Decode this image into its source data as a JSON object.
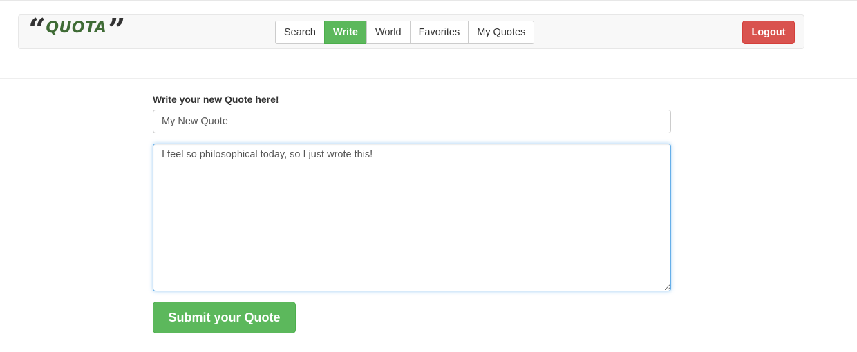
{
  "brand": {
    "open_quote": "“",
    "name": "QUOTA",
    "close_quote": "”",
    "color": "#3f6b35"
  },
  "nav": {
    "items": [
      {
        "label": "Search",
        "active": false
      },
      {
        "label": "Write",
        "active": true
      },
      {
        "label": "World",
        "active": false
      },
      {
        "label": "Favorites",
        "active": false
      },
      {
        "label": "My Quotes",
        "active": false
      }
    ],
    "active_color": "#5cb85c"
  },
  "logout": {
    "label": "Logout",
    "color": "#d9534f"
  },
  "form": {
    "label": "Write your new Quote here!",
    "title_value": "My New Quote",
    "body_value": "I feel so philosophical today, so I just wrote this!",
    "submit_label": "Submit your Quote",
    "submit_color": "#5cb85c"
  }
}
